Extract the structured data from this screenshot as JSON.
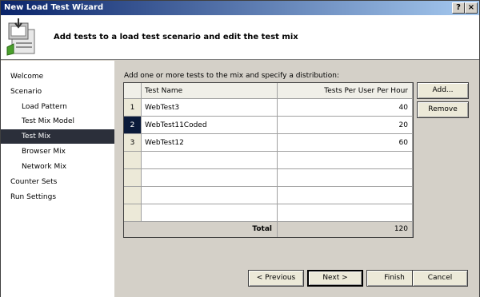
{
  "window": {
    "title": "New Load Test Wizard",
    "help_glyph": "?",
    "close_glyph": "×"
  },
  "header": {
    "title": "Add tests to a load test scenario and edit the test mix",
    "icon": "wizard-document-icon"
  },
  "nav": {
    "items": [
      {
        "label": "Welcome",
        "level": 0,
        "selected": false
      },
      {
        "label": "Scenario",
        "level": 0,
        "selected": false
      },
      {
        "label": "Load Pattern",
        "level": 1,
        "selected": false
      },
      {
        "label": "Test Mix Model",
        "level": 1,
        "selected": false
      },
      {
        "label": "Test Mix",
        "level": 1,
        "selected": true
      },
      {
        "label": "Browser Mix",
        "level": 1,
        "selected": false
      },
      {
        "label": "Network Mix",
        "level": 1,
        "selected": false
      },
      {
        "label": "Counter Sets",
        "level": 0,
        "selected": false
      },
      {
        "label": "Run Settings",
        "level": 0,
        "selected": false
      }
    ]
  },
  "content": {
    "instruction": "Add one or more tests to the mix and specify a distribution:",
    "table": {
      "columns": [
        "Test Name",
        "Tests Per User Per Hour"
      ],
      "rows": [
        {
          "num": "1",
          "name": "WebTest3",
          "value": "40"
        },
        {
          "num": "2",
          "name": "WebTest11Coded",
          "value": "20"
        },
        {
          "num": "3",
          "name": "WebTest12",
          "value": "60"
        }
      ],
      "total_label": "Total",
      "total_value": "120"
    },
    "buttons": {
      "add": "Add...",
      "remove": "Remove"
    }
  },
  "footer": {
    "previous": "< Previous",
    "next": "Next >",
    "finish": "Finish",
    "cancel": "Cancel"
  }
}
